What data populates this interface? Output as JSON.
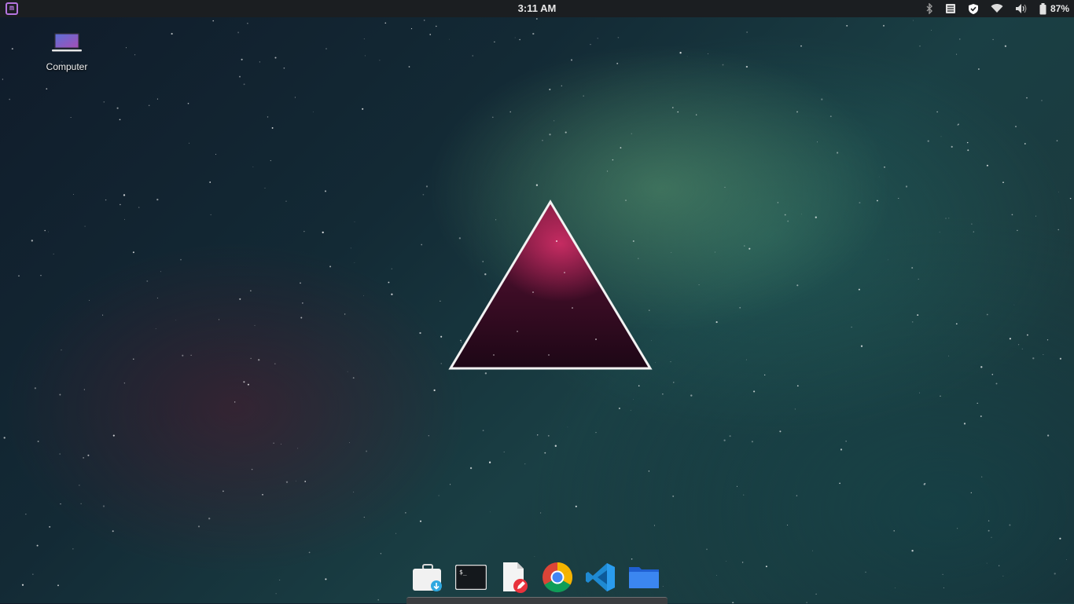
{
  "panel": {
    "menu_icon": "linux-mint-menu-icon",
    "clock": "3:11 AM",
    "tray": {
      "bluetooth_icon": "bluetooth-icon",
      "notes_icon": "notes-icon",
      "shield_icon": "shield-icon",
      "wifi_icon": "wifi-icon",
      "volume_icon": "volume-icon",
      "battery_icon": "battery-icon",
      "battery_text": "87%"
    }
  },
  "desktop": {
    "icons": [
      {
        "label": "Computer",
        "icon": "computer-laptop-icon"
      }
    ],
    "wallpaper": "space-nebula-triangle"
  },
  "dock": {
    "items": [
      {
        "name": "software-manager",
        "icon": "software-manager-icon"
      },
      {
        "name": "terminal",
        "icon": "terminal-icon"
      },
      {
        "name": "text-editor",
        "icon": "text-editor-icon"
      },
      {
        "name": "chrome",
        "icon": "chrome-icon"
      },
      {
        "name": "vscode",
        "icon": "vscode-icon"
      },
      {
        "name": "files",
        "icon": "folder-icon"
      }
    ]
  },
  "colors": {
    "panel_bg": "#1b1e21",
    "mint_accent": "#b574e0",
    "triangle_stroke": "#f2f2f2"
  }
}
